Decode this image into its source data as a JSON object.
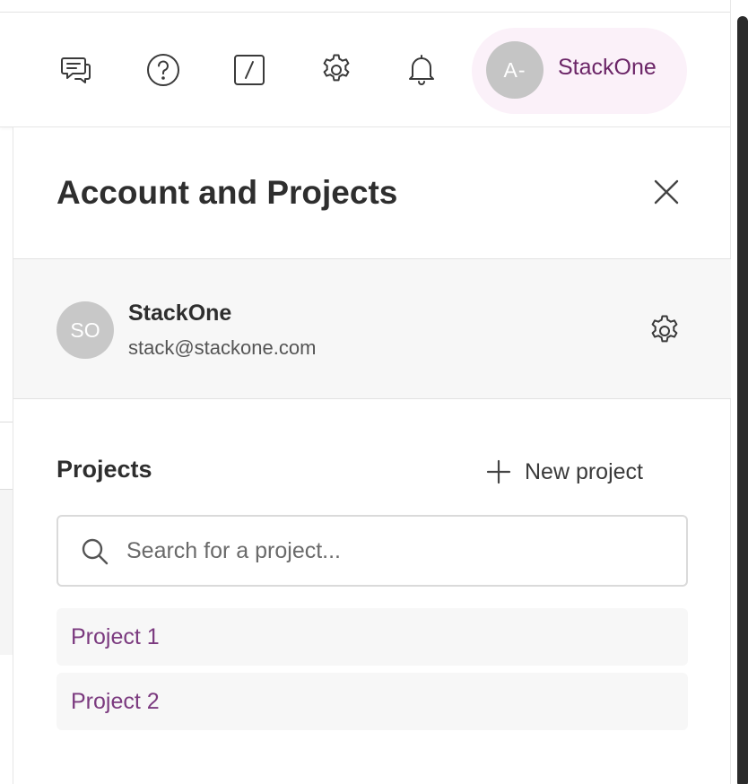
{
  "header": {
    "icons": [
      {
        "name": "feedback-icon"
      },
      {
        "name": "help-icon"
      },
      {
        "name": "slash-command-icon"
      },
      {
        "name": "settings-icon"
      },
      {
        "name": "notifications-icon"
      }
    ],
    "account": {
      "initials": "A-",
      "name": "StackOne",
      "pill_color": "#fbf1f9",
      "name_color": "#6b2567"
    }
  },
  "panel": {
    "title": "Account and Projects",
    "organization": {
      "initials": "SO",
      "name": "StackOne",
      "email": "stack@stackone.com"
    },
    "projects": {
      "title": "Projects",
      "new_project_label": "New project",
      "search_placeholder": "Search for a project...",
      "search_value": "",
      "items": [
        {
          "label": "Project 1"
        },
        {
          "label": "Project 2"
        }
      ],
      "item_color": "#7b3a7f"
    }
  }
}
